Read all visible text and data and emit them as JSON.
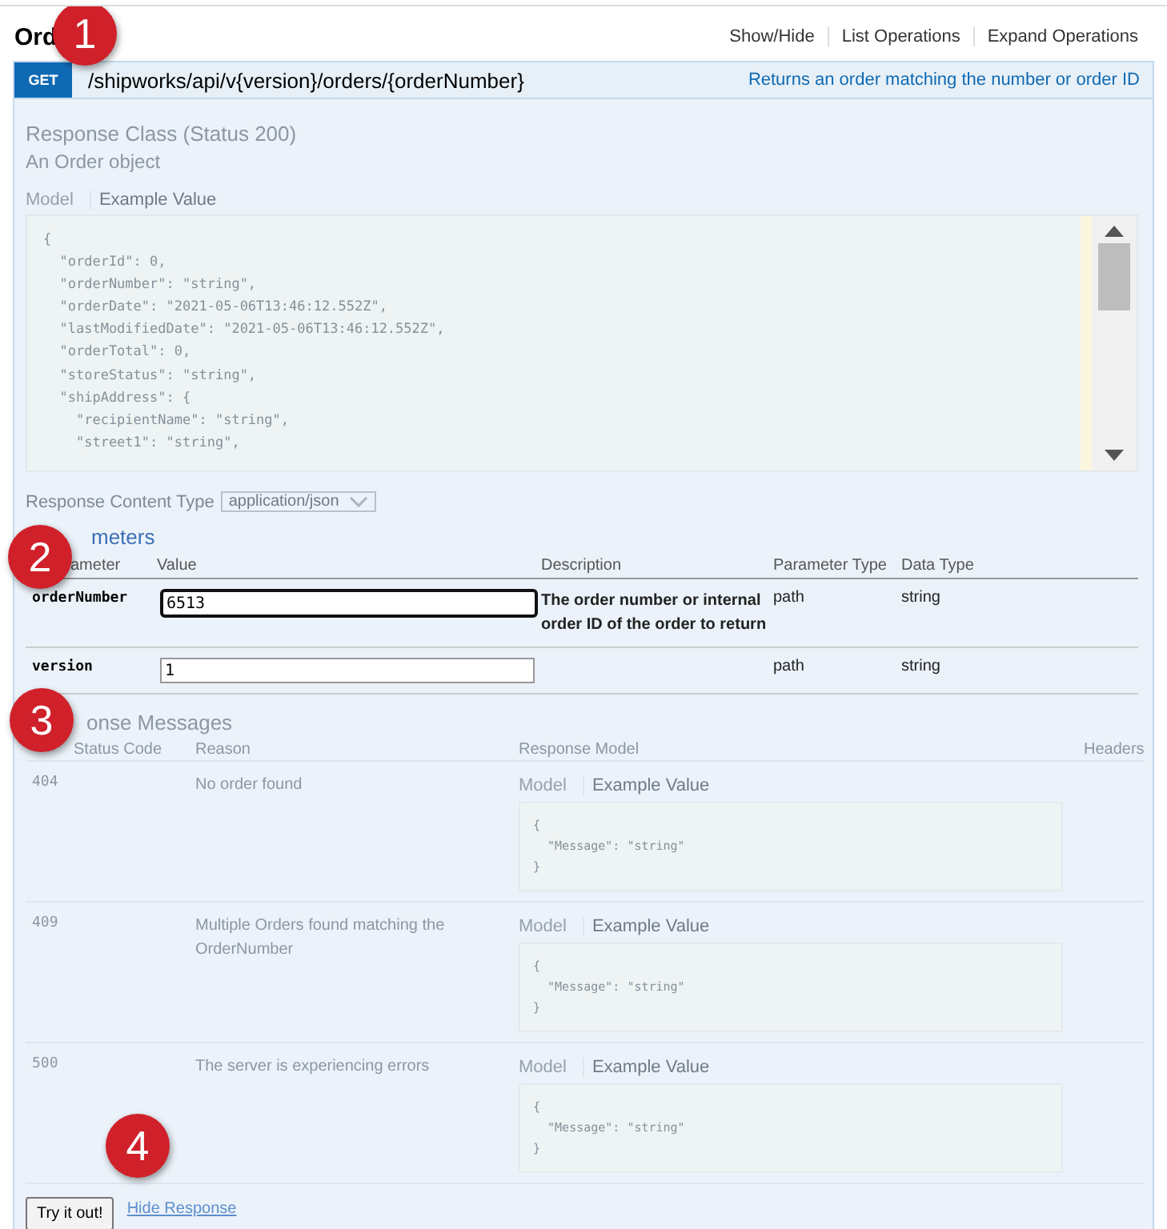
{
  "resource": {
    "title": "Ord",
    "links": [
      "Show/Hide",
      "List Operations",
      "Expand Operations"
    ]
  },
  "operation": {
    "method": "GET",
    "path": "/shipworks/api/v{version}/orders/{orderNumber}",
    "summary": "Returns an order matching the number or order ID"
  },
  "response_class": {
    "title": "Response Class (Status 200)",
    "description": "An Order object",
    "tabs": [
      {
        "label": "Model",
        "selected": false
      },
      {
        "label": "Example Value",
        "selected": true
      }
    ],
    "code": [
      "{",
      "  \"orderId\": 0,",
      "  \"orderNumber\": \"string\",",
      "  \"orderDate\": \"2021-05-06T13:46:12.552Z\",",
      "  \"lastModifiedDate\": \"2021-05-06T13:46:12.552Z\",",
      "  \"orderTotal\": 0,",
      "  \"storeStatus\": \"string\",",
      "  \"shipAddress\": {",
      "    \"recipientName\": \"string\",",
      "    \"street1\": \"string\","
    ]
  },
  "content_type": {
    "label": "Response Content Type",
    "value": "application/json"
  },
  "parameters": {
    "title": "meters",
    "columns": [
      "ameter",
      "Value",
      "Description",
      "Parameter Type",
      "Data Type"
    ],
    "rows": [
      {
        "name": "orderNumber",
        "value": "6513",
        "focused": true,
        "description": "The order number or internal order ID of the order to return",
        "param_type": "path",
        "data_type": "string"
      },
      {
        "name": "version",
        "value": "1",
        "focused": false,
        "param_type": "path",
        "data_type": "string"
      }
    ]
  },
  "response_messages": {
    "title": "onse Messages",
    "columns": [
      "Status Code",
      "Reason",
      "Response Model",
      "Headers"
    ],
    "rows": [
      {
        "code": "404",
        "reason": "No order found",
        "tabs": [
          {
            "label": "Model",
            "selected": false
          },
          {
            "label": "Example Value",
            "selected": true
          }
        ],
        "example": [
          "{",
          "  \"Message\": \"string\"",
          "}"
        ]
      },
      {
        "code": "409",
        "reason": "Multiple Orders found matching the OrderNumber",
        "tabs": [
          {
            "label": "Model",
            "selected": false
          },
          {
            "label": "Example Value",
            "selected": true
          }
        ],
        "example": [
          "{",
          "  \"Message\": \"string\"",
          "}"
        ]
      },
      {
        "code": "500",
        "reason": "The server is experiencing errors",
        "tabs": [
          {
            "label": "Model",
            "selected": false
          },
          {
            "label": "Example Value",
            "selected": true
          }
        ],
        "example": [
          "{",
          "  \"Message\": \"string\"",
          "}"
        ]
      }
    ]
  },
  "actions": {
    "button": "Try it out!",
    "link": "Hide Response"
  },
  "callouts": [
    "1",
    "2",
    "3",
    "4"
  ]
}
